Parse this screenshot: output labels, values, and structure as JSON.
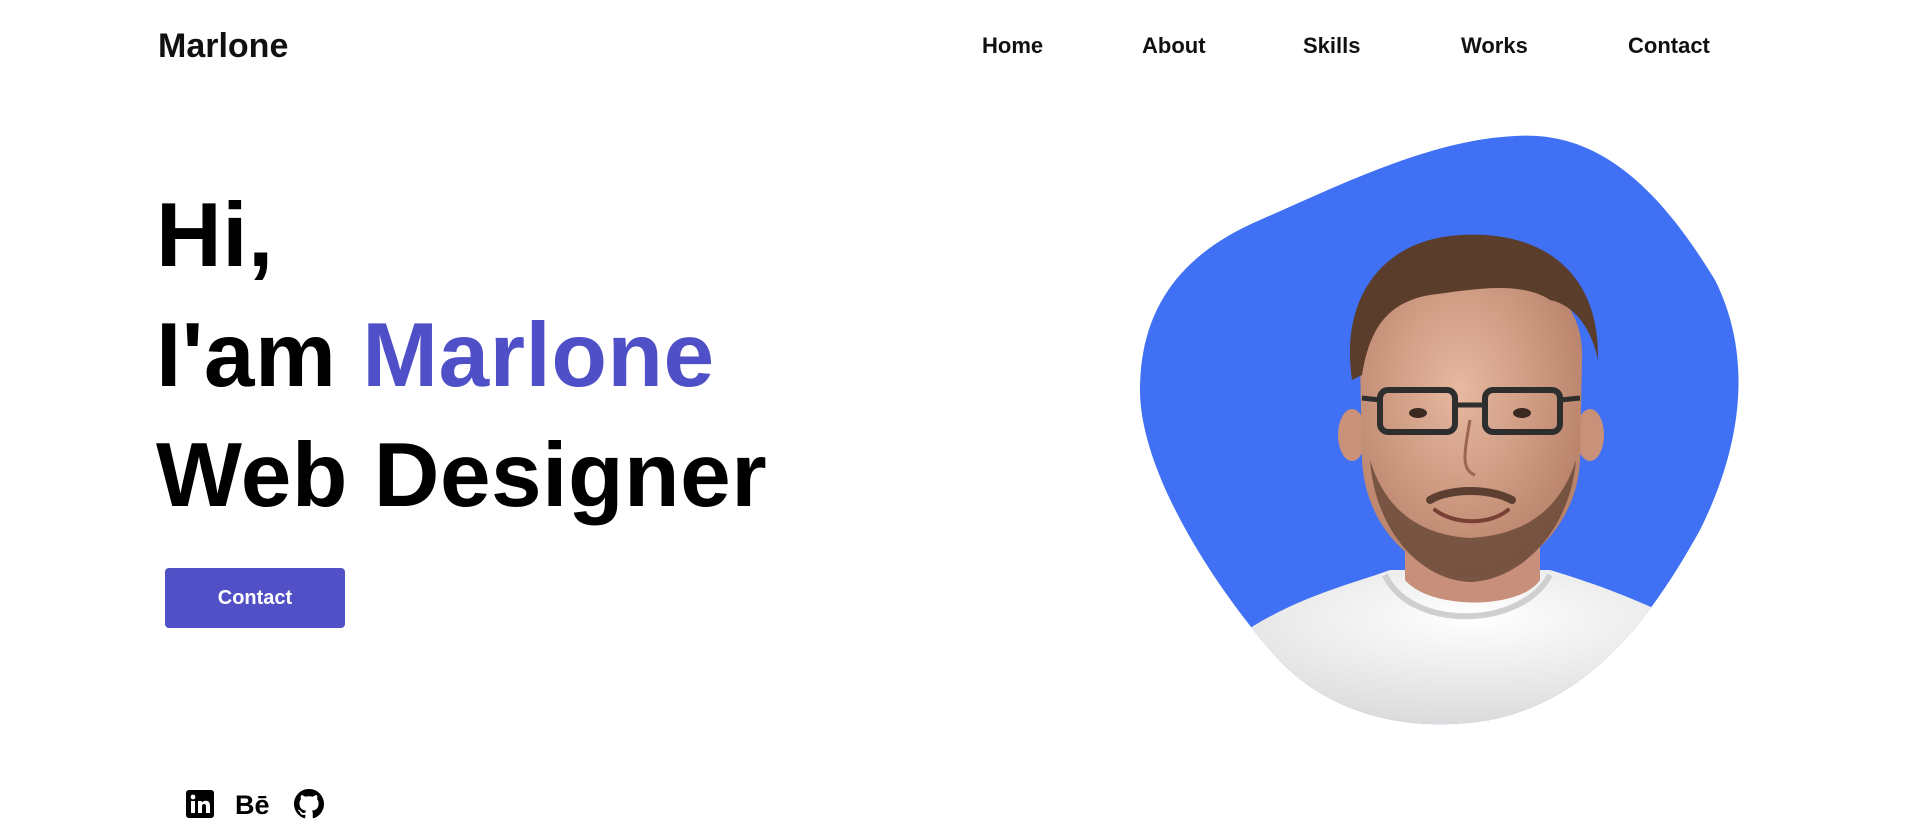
{
  "header": {
    "logo": "Marlone",
    "nav": [
      {
        "label": "Home"
      },
      {
        "label": "About"
      },
      {
        "label": "Skills"
      },
      {
        "label": "Works"
      },
      {
        "label": "Contact"
      }
    ]
  },
  "hero": {
    "line1": "Hi,",
    "line2_prefix": "I'am ",
    "line2_name": "Marlone",
    "line3": "Web Designer",
    "button_label": "Contact"
  },
  "social": [
    {
      "icon": "linkedin-icon"
    },
    {
      "icon": "behance-icon"
    },
    {
      "icon": "github-icon"
    }
  ],
  "image": {
    "subject": "portrait-photo",
    "blob_color": "#4070f4"
  },
  "colors": {
    "accent": "#4f4fc8",
    "button": "#5150c6",
    "blob": "#4070f4",
    "text": "#000000",
    "background": "#ffffff"
  }
}
